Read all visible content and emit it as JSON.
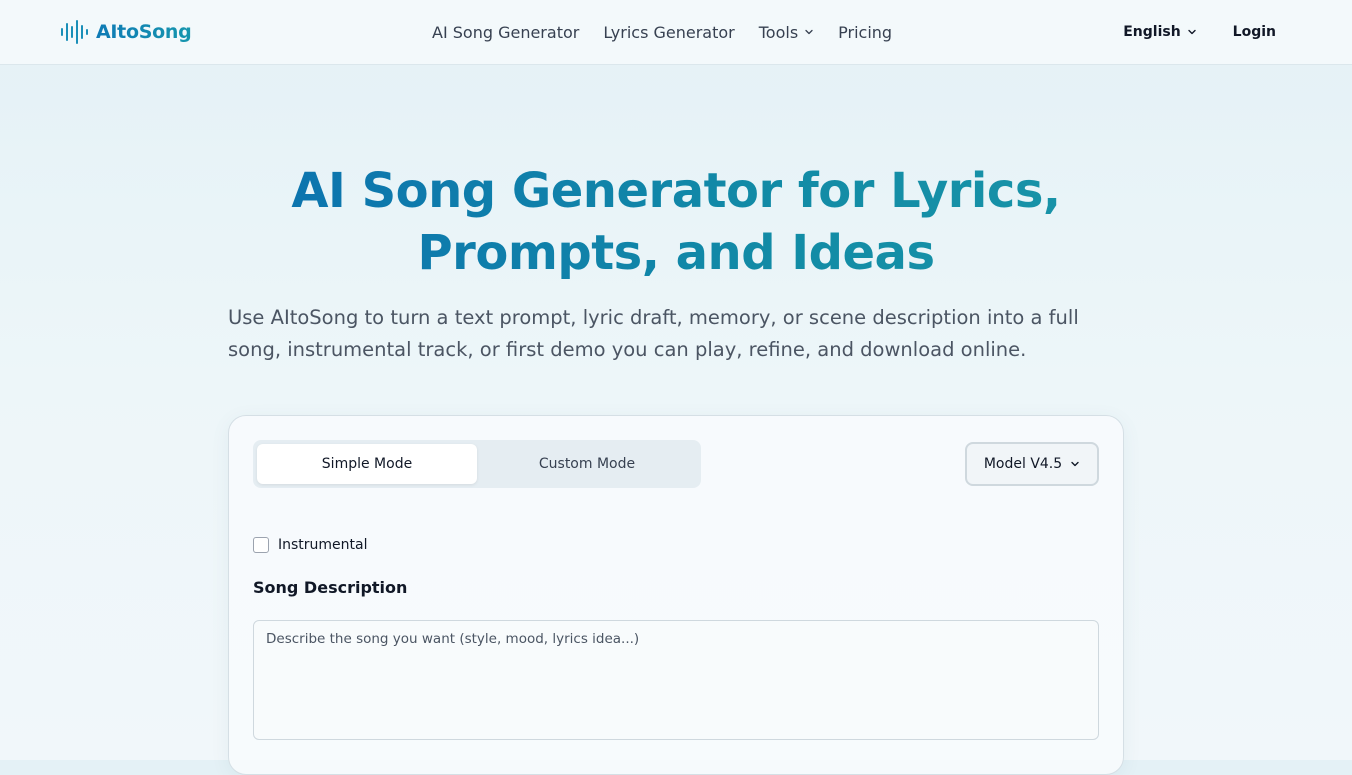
{
  "nav": {
    "brand": "AItoSong",
    "links": [
      {
        "label": "AI Song Generator"
      },
      {
        "label": "Lyrics Generator"
      },
      {
        "label": "Tools",
        "icon": "chevron-down-icon"
      },
      {
        "label": "Pricing"
      }
    ],
    "language": "English",
    "login": "Login"
  },
  "hero": {
    "title": "AI Song Generator for Lyrics, Prompts, and Ideas",
    "subtitle": "Use AItoSong to turn a text prompt, lyric draft, memory, or scene description into a full song, instrumental track, or first demo you can play, refine, and download online."
  },
  "generator": {
    "tabs": [
      {
        "label": "Simple Mode",
        "active": true
      },
      {
        "label": "Custom Mode",
        "active": false
      }
    ],
    "model": "Model V4.5",
    "instrumental_label": "Instrumental",
    "instrumental_checked": false,
    "description_label": "Song Description",
    "description_placeholder": "Describe the song you want (style, mood, lyrics idea...)",
    "description_value": ""
  },
  "colors": {
    "brand_start": "#0b6fb0",
    "brand_end": "#1a95a8",
    "logo_icon": "#1a8fb8"
  }
}
